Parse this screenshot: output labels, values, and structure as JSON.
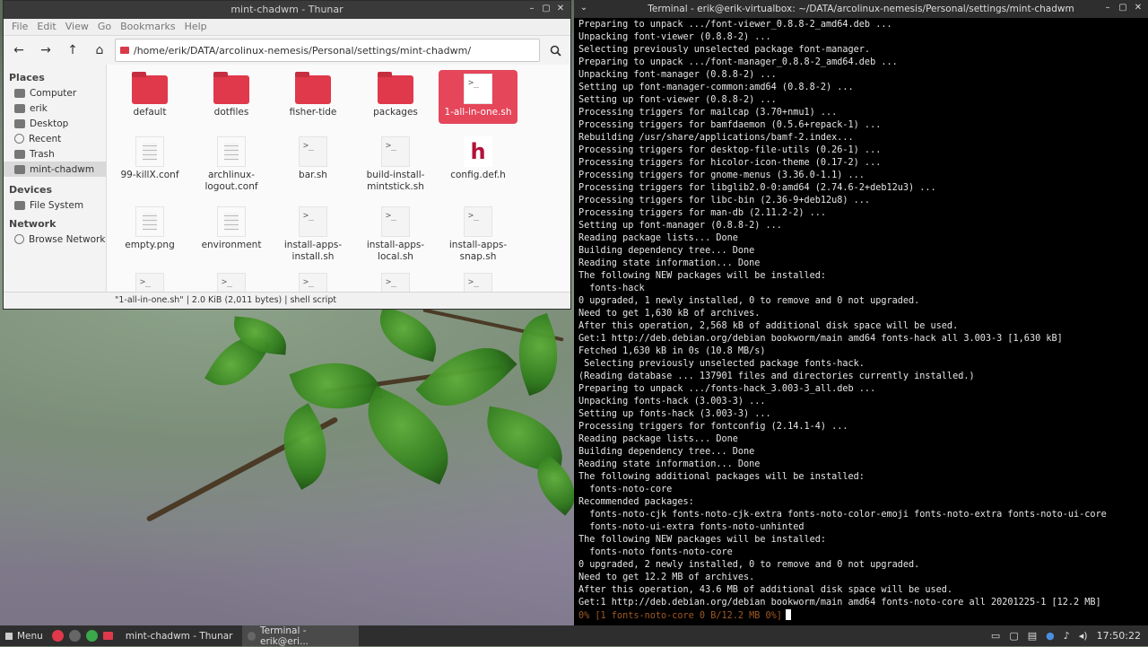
{
  "thunar": {
    "title": "mint-chadwm - Thunar",
    "controls": {
      "minimize": "–",
      "maximize": "▢",
      "close": "✕"
    },
    "menu": [
      "File",
      "Edit",
      "View",
      "Go",
      "Bookmarks",
      "Help"
    ],
    "path": "/home/erik/DATA/arcolinux-nemesis/Personal/settings/mint-chadwm/",
    "sidebar": {
      "places_header": "Places",
      "places": [
        "Computer",
        "erik",
        "Desktop",
        "Recent",
        "Trash",
        "mint-chadwm"
      ],
      "devices_header": "Devices",
      "devices": [
        "File System"
      ],
      "network_header": "Network",
      "network": [
        "Browse Network"
      ]
    },
    "files_row1": [
      {
        "name": "default",
        "kind": "folder"
      },
      {
        "name": "dotfiles",
        "kind": "folder"
      },
      {
        "name": "fisher-tide",
        "kind": "folder"
      },
      {
        "name": "packages",
        "kind": "folder"
      },
      {
        "name": "1-all-in-one.sh",
        "kind": "script",
        "selected": true
      }
    ],
    "files_row2": [
      {
        "name": "99-killX.conf",
        "kind": "text"
      },
      {
        "name": "archlinux-logout.conf",
        "kind": "text"
      },
      {
        "name": "bar.sh",
        "kind": "script"
      },
      {
        "name": "build-install-mintstick.sh",
        "kind": "script"
      },
      {
        "name": "config.def.h",
        "kind": "header"
      }
    ],
    "files_row3": [
      {
        "name": "empty.png",
        "kind": "text"
      },
      {
        "name": "environment",
        "kind": "text"
      },
      {
        "name": "install-apps-install.sh",
        "kind": "script"
      },
      {
        "name": "install-apps-local.sh",
        "kind": "script"
      },
      {
        "name": "install-apps-snap.sh",
        "kind": "script"
      }
    ],
    "script_glyph": ">_",
    "header_glyph": "h",
    "status": "\"1-all-in-one.sh\" | 2.0 KiB (2,011 bytes) | shell script"
  },
  "terminal": {
    "title": "Terminal - erik@erik-virtualbox: ~/DATA/arcolinux-nemesis/Personal/settings/mint-chadwm",
    "lines": [
      "Preparing to unpack .../font-viewer_0.8.8-2_amd64.deb ...",
      "Unpacking font-viewer (0.8.8-2) ...",
      "Selecting previously unselected package font-manager.",
      "Preparing to unpack .../font-manager_0.8.8-2_amd64.deb ...",
      "Unpacking font-manager (0.8.8-2) ...",
      "Setting up font-manager-common:amd64 (0.8.8-2) ...",
      "Setting up font-viewer (0.8.8-2) ...",
      "Processing triggers for mailcap (3.70+nmu1) ...",
      "Processing triggers for bamfdaemon (0.5.6+repack-1) ...",
      "Rebuilding /usr/share/applications/bamf-2.index...",
      "Processing triggers for desktop-file-utils (0.26-1) ...",
      "Processing triggers for hicolor-icon-theme (0.17-2) ...",
      "Processing triggers for gnome-menus (3.36.0-1.1) ...",
      "Processing triggers for libglib2.0-0:amd64 (2.74.6-2+deb12u3) ...",
      "Processing triggers for libc-bin (2.36-9+deb12u8) ...",
      "Processing triggers for man-db (2.11.2-2) ...",
      "Setting up font-manager (0.8.8-2) ...",
      "Reading package lists... Done",
      "Building dependency tree... Done",
      "Reading state information... Done",
      "The following NEW packages will be installed:",
      "  fonts-hack",
      "0 upgraded, 1 newly installed, 0 to remove and 0 not upgraded.",
      "Need to get 1,630 kB of archives.",
      "After this operation, 2,568 kB of additional disk space will be used.",
      "Get:1 http://deb.debian.org/debian bookworm/main amd64 fonts-hack all 3.003-3 [1,630 kB]",
      "Fetched 1,630 kB in 0s (10.8 MB/s)",
      " Selecting previously unselected package fonts-hack.",
      "(Reading database ... 137901 files and directories currently installed.)",
      "Preparing to unpack .../fonts-hack_3.003-3_all.deb ...",
      "Unpacking fonts-hack (3.003-3) ...",
      "Setting up fonts-hack (3.003-3) ...",
      "Processing triggers for fontconfig (2.14.1-4) ...",
      "Reading package lists... Done",
      "Building dependency tree... Done",
      "Reading state information... Done",
      "The following additional packages will be installed:",
      "  fonts-noto-core",
      "Recommended packages:",
      "  fonts-noto-cjk fonts-noto-cjk-extra fonts-noto-color-emoji fonts-noto-extra fonts-noto-ui-core",
      "  fonts-noto-ui-extra fonts-noto-unhinted",
      "The following NEW packages will be installed:",
      "  fonts-noto fonts-noto-core",
      "0 upgraded, 2 newly installed, 0 to remove and 0 not upgraded.",
      "Need to get 12.2 MB of archives.",
      "After this operation, 43.6 MB of additional disk space will be used.",
      "Get:1 http://deb.debian.org/debian bookworm/main amd64 fonts-noto-core all 20201225-1 [12.2 MB]"
    ],
    "progress_line": "0% [1 fonts-noto-core 0 B/12.2 MB 0%]"
  },
  "taskbar": {
    "menu_label": "Menu",
    "task_thunar": "mint-chadwm - Thunar",
    "task_terminal": "Terminal - erik@eri...",
    "clock": "17:50:22"
  }
}
